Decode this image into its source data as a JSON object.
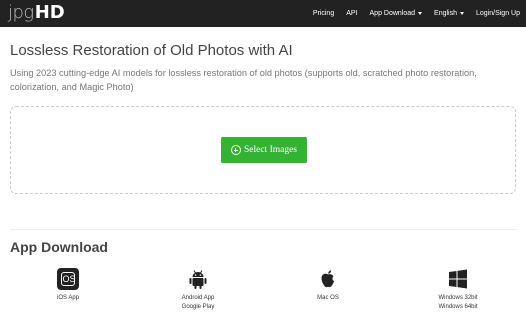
{
  "brand": {
    "logo_light": "jpg",
    "logo_bold": "HD"
  },
  "nav": {
    "pricing": "Pricing",
    "api": "API",
    "app_download": "App Download",
    "language": "English",
    "login": "Login/Sign Up"
  },
  "hero": {
    "title": "Lossless Restoration of Old Photos with AI",
    "subtitle": "Using 2023 cutting-edge AI models for lossless restoration of old photos (supports old, scratched photo restoration, colorization, and Magic Photo)"
  },
  "upload": {
    "button_label": "Select Images"
  },
  "download": {
    "title": "App Download",
    "apps": [
      {
        "line1": "iOS App",
        "line2": "",
        "icon": "ios-icon",
        "icon_text": "iOS"
      },
      {
        "line1": "Android App",
        "line2": "Google Play",
        "icon": "android-icon"
      },
      {
        "line1": "Mac OS",
        "line2": "",
        "icon": "apple-icon"
      },
      {
        "line1": "Windows 32bit",
        "line2": "Windows 64bit",
        "icon": "windows-icon"
      }
    ]
  }
}
